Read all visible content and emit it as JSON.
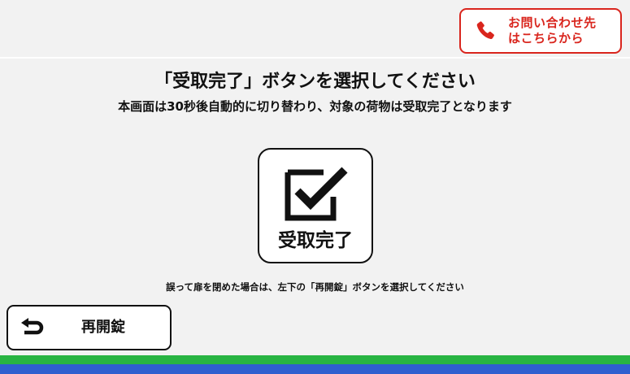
{
  "header": {
    "contact_button_label": "お問い合わせ先\nはこちらから",
    "accent_color": "#d9251d",
    "contact_icon": "phone-icon"
  },
  "main": {
    "title": "「受取完了」ボタンを選択してください",
    "subtitle": "本画面は30秒後自動的に切り替わり、対象の荷物は受取完了となります",
    "complete_button_label": "受取完了",
    "complete_icon": "checkbox-checked-icon",
    "note": "誤って扉を閉めた場合は、左下の「再開錠」ボタンを選択してください"
  },
  "footer": {
    "relock_button_label": "再開錠",
    "relock_icon": "return-arrow-icon",
    "stripe_colors": [
      "#28b442",
      "#2f5fcf"
    ]
  }
}
